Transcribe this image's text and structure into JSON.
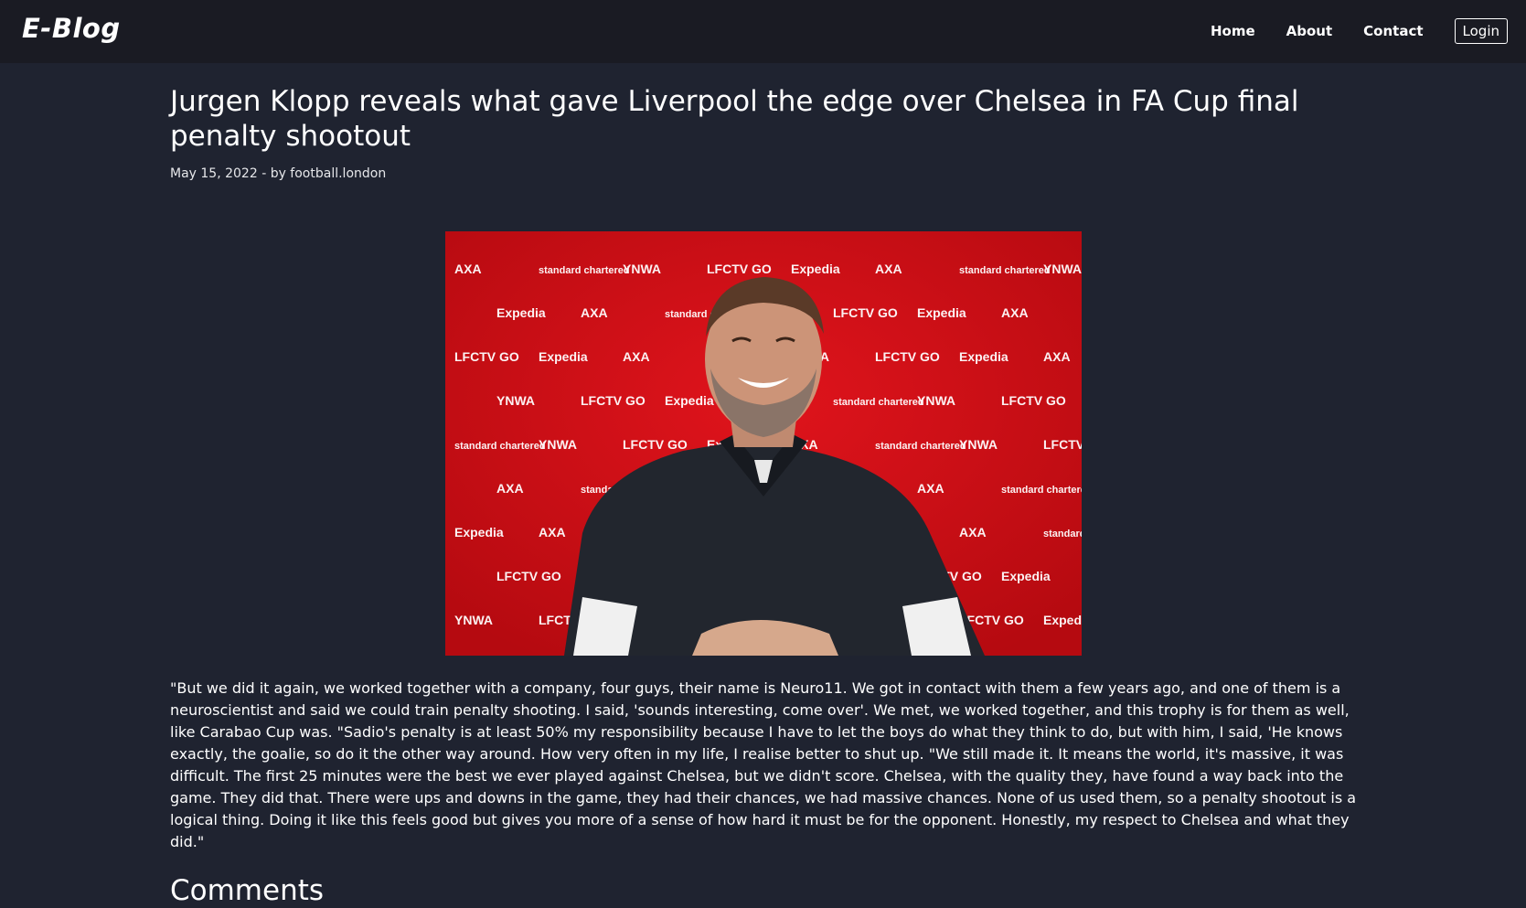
{
  "nav": {
    "brand": "E-Blog",
    "links": [
      "Home",
      "About",
      "Contact"
    ],
    "login": "Login"
  },
  "article": {
    "title": "Jurgen Klopp reveals what gave Liverpool the edge over Chelsea in FA Cup final penalty shootout",
    "meta": "May 15, 2022 - by football.london",
    "body": "\"But we did it again, we worked together with a company, four guys, their name is Neuro11. We got in contact with them a few years ago, and one of them is a neuroscientist and said we could train penalty shooting. I said, 'sounds interesting, come over'. We met, we worked together, and this trophy is for them as well, like Carabao Cup was. \"Sadio's penalty is at least 50% my responsibility because I have to let the boys do what they think to do, but with him, I said, 'He knows exactly, the goalie, so do it the other way around. How very often in my life, I realise better to shut up. \"We still made it. It means the world, it's massive, it was difficult. The first 25 minutes were the best we ever played against Chelsea, but we didn't score. Chelsea, with the quality they, have found a way back into the game. They did that. There were ups and downs in the game, they had their chances, we had massive chances. None of us used them, so a penalty shootout is a logical thing. Doing it like this feels good but gives you more of a sense of how hard it must be for the opponent. Honestly, my respect to Chelsea and what they did.\""
  },
  "hero_image": {
    "backdrop_words": [
      "AXA",
      "LFCTV GO",
      "standard chartered",
      "Expedia",
      "YNWA"
    ]
  },
  "comments": {
    "heading": "Comments"
  },
  "colors": {
    "navbar_bg": "#1a1b23",
    "page_bg": "#1f2330",
    "backdrop_red": "#d10e15",
    "text": "#ffffff"
  }
}
